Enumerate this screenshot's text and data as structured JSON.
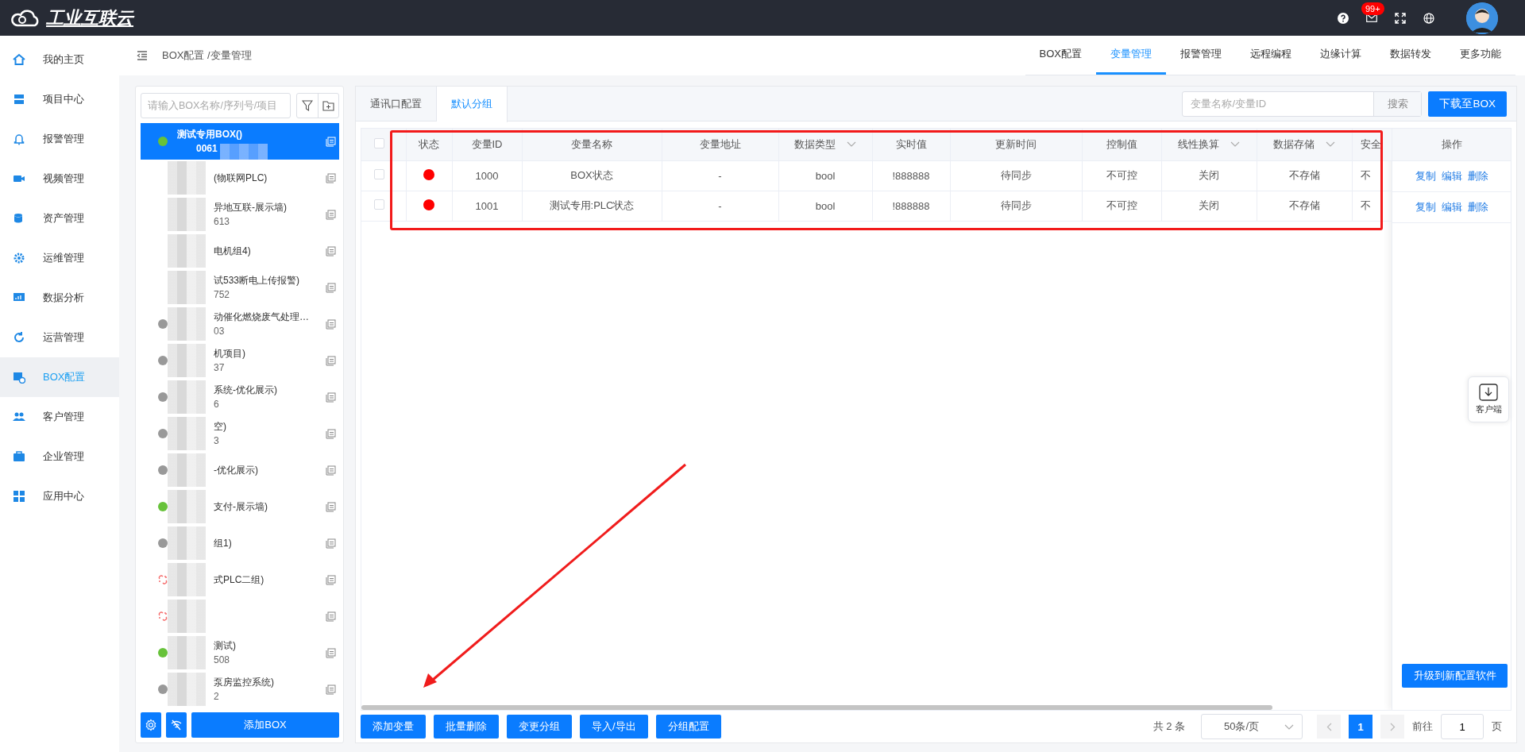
{
  "topbar": {
    "logo_text": "工业互联云",
    "mail_badge": "99+"
  },
  "sidebar": {
    "items": [
      {
        "label": "我的主页",
        "selected": false
      },
      {
        "label": "项目中心",
        "selected": false
      },
      {
        "label": "报警管理",
        "selected": false
      },
      {
        "label": "视频管理",
        "selected": false
      },
      {
        "label": "资产管理",
        "selected": false
      },
      {
        "label": "运维管理",
        "selected": false
      },
      {
        "label": "数据分析",
        "selected": false
      },
      {
        "label": "运营管理",
        "selected": false
      },
      {
        "label": "BOX配置",
        "selected": true
      },
      {
        "label": "客户管理",
        "selected": false
      },
      {
        "label": "企业管理",
        "selected": false
      },
      {
        "label": "应用中心",
        "selected": false
      }
    ]
  },
  "breadcrumb": "BOX配置 /变量管理",
  "top_tabs": [
    {
      "label": "BOX配置",
      "selected": false
    },
    {
      "label": "变量管理",
      "selected": true
    },
    {
      "label": "报警管理",
      "selected": false
    },
    {
      "label": "远程编程",
      "selected": false
    },
    {
      "label": "边缘计算",
      "selected": false
    },
    {
      "label": "数据转发",
      "selected": false
    },
    {
      "label": "更多功能",
      "selected": false
    }
  ],
  "box_panel": {
    "search": {
      "placeholder": "请输入BOX名称/序列号/项目"
    },
    "items": [
      {
        "name": "测试专用BOX()",
        "serial": "0061",
        "kind": "dot",
        "color": "#67c23a",
        "selected": true
      },
      {
        "name": "(物联网PLC)",
        "selected": false
      },
      {
        "name": "异地互联-展示墙)",
        "serial": "613",
        "selected": false
      },
      {
        "name": "电机组4)",
        "selected": false
      },
      {
        "name": "试533断电上传报警)",
        "serial": "752",
        "selected": false
      },
      {
        "name": "动催化燃烧废气处理…",
        "serial": "03",
        "kind": "dot",
        "color": "#999999",
        "selected": false
      },
      {
        "name": "机项目)",
        "serial": "37",
        "kind": "dot",
        "color": "#999999",
        "selected": false
      },
      {
        "name": "系统-优化展示)",
        "serial": "6",
        "kind": "dot",
        "color": "#999999",
        "selected": false
      },
      {
        "name": "空)",
        "serial": "3",
        "kind": "dot",
        "color": "#999999",
        "selected": false
      },
      {
        "name": "-优化展示)",
        "kind": "dot",
        "color": "#999999",
        "selected": false
      },
      {
        "name": "支付-展示墙)",
        "kind": "dot",
        "color": "#67c23a",
        "selected": false
      },
      {
        "name": "组1)",
        "kind": "dot",
        "color": "#999999",
        "selected": false
      },
      {
        "name": "式PLC二组)",
        "kind": "broken-link",
        "selected": false
      },
      {
        "kind": "broken-link",
        "selected": false
      },
      {
        "name": "测试)",
        "serial": "508",
        "kind": "dot",
        "color": "#67c23a",
        "selected": false
      },
      {
        "name": "泵房监控系统)",
        "serial": "2",
        "kind": "dot",
        "color": "#999999",
        "selected": false
      }
    ],
    "add_button": "添加BOX"
  },
  "group_tabs": [
    {
      "label": "通讯口配置",
      "selected": false
    },
    {
      "label": "默认分组",
      "selected": true
    }
  ],
  "var_search": {
    "placeholder": "变量名称/变量ID",
    "button": "搜索"
  },
  "download_button": "下载至BOX",
  "table": {
    "columns": [
      {
        "kind": "checkbox",
        "checked": false
      },
      {
        "label": "状态",
        "filter": false
      },
      {
        "label": "变量ID",
        "filter": false
      },
      {
        "label": "变量名称",
        "filter": false
      },
      {
        "label": "变量地址",
        "filter": false
      },
      {
        "label": "数据类型",
        "filter": true
      },
      {
        "label": "实时值",
        "filter": false
      },
      {
        "label": "更新时间",
        "filter": false
      },
      {
        "label": "控制值",
        "filter": false
      },
      {
        "label": "线性换算",
        "filter": true
      },
      {
        "label": "数据存储",
        "filter": true
      },
      {
        "label": "安全",
        "filter": false
      }
    ],
    "action_column": "操作",
    "rows": [
      {
        "cells": [
          {
            "kind": "checkbox",
            "checked": false
          },
          {
            "kind": "status",
            "color": "#ff0000"
          },
          "1000",
          "BOX状态",
          "-",
          "bool",
          "!888888",
          "待同步",
          "不可控",
          "关闭",
          "不存储",
          "不"
        ],
        "actions": [
          "复制",
          "编辑",
          "删除"
        ]
      },
      {
        "cells": [
          {
            "kind": "checkbox",
            "checked": false
          },
          {
            "kind": "status",
            "color": "#ff0000"
          },
          "1001",
          "测试专用:PLC状态",
          "-",
          "bool",
          "!888888",
          "待同步",
          "不可控",
          "关闭",
          "不存储",
          "不"
        ],
        "actions": [
          "复制",
          "编辑",
          "删除"
        ]
      }
    ]
  },
  "upgrade_button": "升级到新配置软件",
  "client_widget": "客户端",
  "bottom_buttons": [
    "添加变量",
    "批量删除",
    "变更分组",
    "导入/导出",
    "分组配置"
  ],
  "pagination": {
    "total": "共 2 条",
    "page_size": "50条/页",
    "pages": [
      {
        "label": "1",
        "selected": true
      }
    ],
    "goto_label": "前往",
    "goto_value": "1",
    "goto_suffix": "页"
  }
}
